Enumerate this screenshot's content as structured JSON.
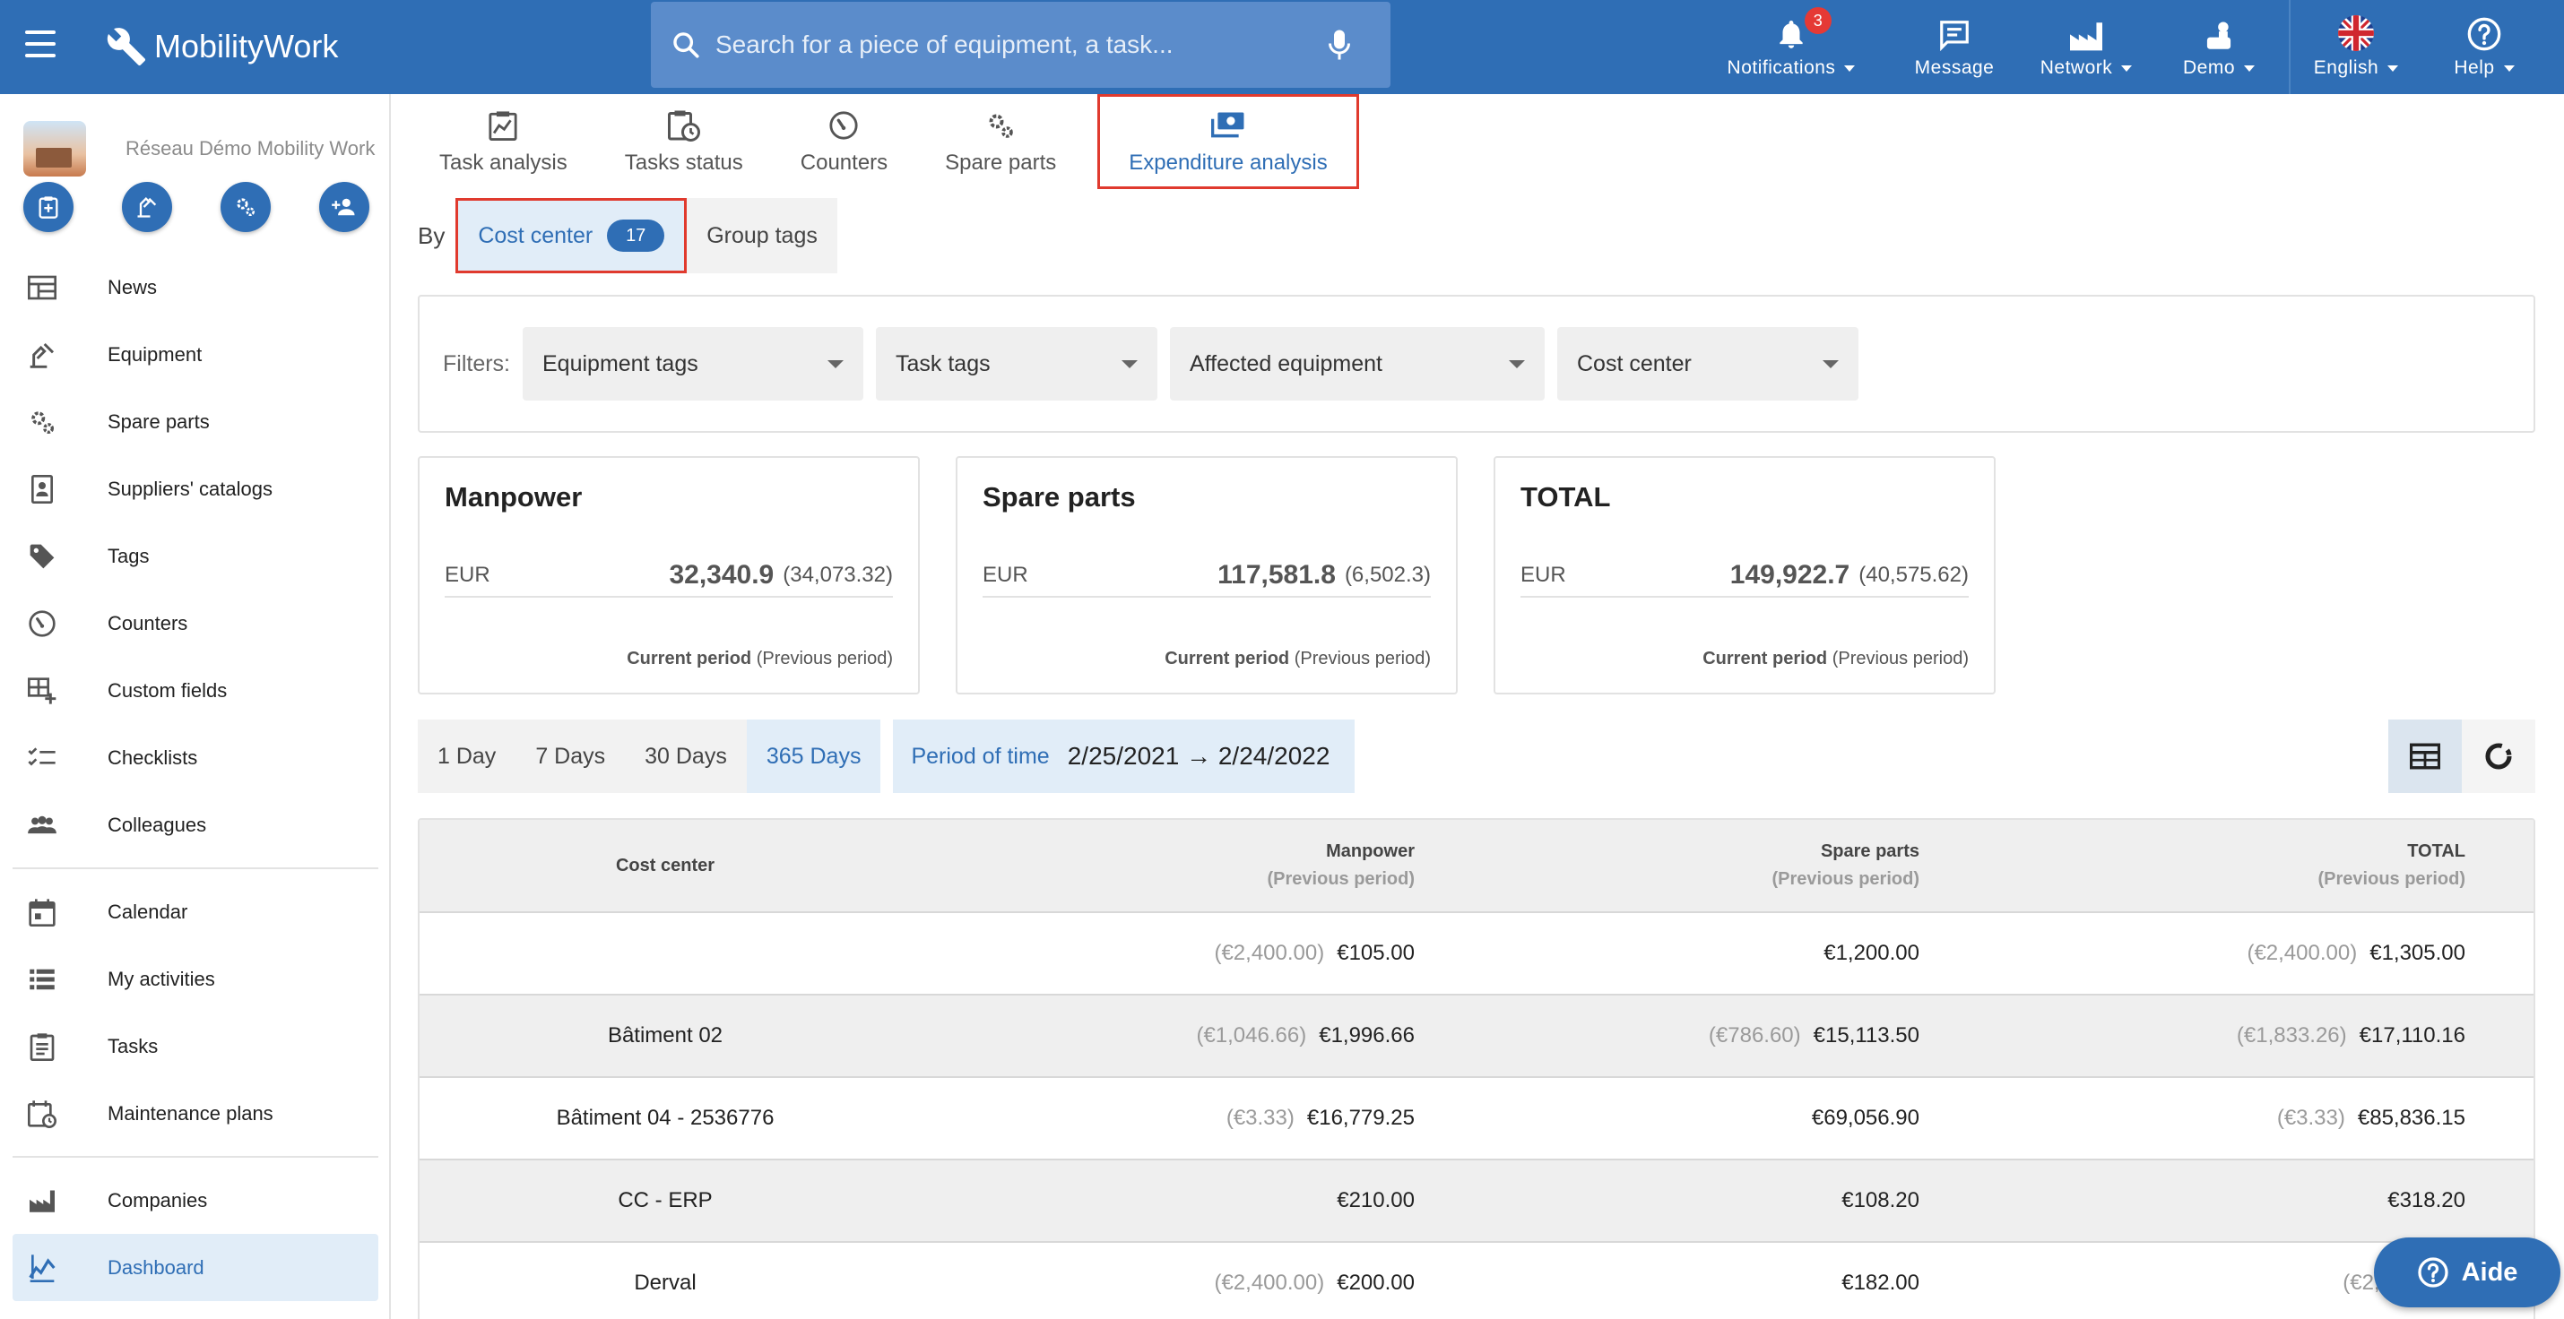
{
  "app": {
    "name": "MobilityWork"
  },
  "search": {
    "placeholder": "Search for a piece of equipment, a task..."
  },
  "topnav": {
    "notifications": {
      "label": "Notifications",
      "badge": "3"
    },
    "message": {
      "label": "Message"
    },
    "network": {
      "label": "Network"
    },
    "demo": {
      "label": "Demo"
    },
    "language": {
      "label": "English"
    },
    "help": {
      "label": "Help"
    }
  },
  "sidebar": {
    "org_name": "Réseau Démo Mobility Work",
    "items": [
      {
        "label": "News",
        "icon": "news-icon"
      },
      {
        "label": "Equipment",
        "icon": "equipment-icon"
      },
      {
        "label": "Spare parts",
        "icon": "gears-icon"
      },
      {
        "label": "Suppliers' catalogs",
        "icon": "catalog-icon"
      },
      {
        "label": "Tags",
        "icon": "tag-icon"
      },
      {
        "label": "Counters",
        "icon": "gauge-icon"
      },
      {
        "label": "Custom fields",
        "icon": "custom-fields-icon"
      },
      {
        "label": "Checklists",
        "icon": "checklist-icon"
      },
      {
        "label": "Colleagues",
        "icon": "people-icon"
      },
      {
        "label": "Calendar",
        "icon": "calendar-icon"
      },
      {
        "label": "My activities",
        "icon": "list-icon"
      },
      {
        "label": "Tasks",
        "icon": "clipboard-icon"
      },
      {
        "label": "Maintenance plans",
        "icon": "maintenance-plan-icon"
      },
      {
        "label": "Companies",
        "icon": "factory-icon"
      },
      {
        "label": "Dashboard",
        "icon": "dashboard-icon"
      }
    ]
  },
  "tabs": [
    "Task analysis",
    "Tasks status",
    "Counters",
    "Spare parts",
    "Expenditure analysis"
  ],
  "by": {
    "label": "By",
    "cost_center": "Cost center",
    "cost_center_count": "17",
    "group_tags": "Group tags"
  },
  "filters": {
    "label": "Filters:",
    "items": [
      "Equipment tags",
      "Task tags",
      "Affected equipment",
      "Cost center"
    ]
  },
  "cards": [
    {
      "title": "Manpower",
      "currency": "EUR",
      "value": "32,340.9",
      "previous": "(34,073.32)",
      "foot_current": "Current period",
      "foot_previous": "(Previous period)"
    },
    {
      "title": "Spare parts",
      "currency": "EUR",
      "value": "117,581.8",
      "previous": "(6,502.3)",
      "foot_current": "Current period",
      "foot_previous": "(Previous period)"
    },
    {
      "title": "TOTAL",
      "currency": "EUR",
      "value": "149,922.7",
      "previous": "(40,575.62)",
      "foot_current": "Current period",
      "foot_previous": "(Previous period)"
    }
  ],
  "periods": [
    "1 Day",
    "7 Days",
    "30 Days",
    "365 Days"
  ],
  "range": {
    "label": "Period of time",
    "value": "2/25/2021 → 2/24/2022"
  },
  "table": {
    "headers": {
      "cost_center": "Cost center",
      "manpower": "Manpower",
      "spare_parts": "Spare parts",
      "total": "TOTAL",
      "previous": "(Previous period)"
    },
    "rows": [
      {
        "name": "",
        "man_prev": "(€2,400.00)",
        "man": "€105.00",
        "sp_prev": "",
        "sp": "€1,200.00",
        "tot_prev": "(€2,400.00)",
        "tot": "€1,305.00"
      },
      {
        "name": "Bâtiment 02",
        "man_prev": "(€1,046.66)",
        "man": "€1,996.66",
        "sp_prev": "(€786.60)",
        "sp": "€15,113.50",
        "tot_prev": "(€1,833.26)",
        "tot": "€17,110.16"
      },
      {
        "name": "Bâtiment 04 - 2536776",
        "man_prev": "(€3.33)",
        "man": "€16,779.25",
        "sp_prev": "",
        "sp": "€69,056.90",
        "tot_prev": "(€3.33)",
        "tot": "€85,836.15"
      },
      {
        "name": "CC - ERP",
        "man_prev": "",
        "man": "€210.00",
        "sp_prev": "",
        "sp": "€108.20",
        "tot_prev": "",
        "tot": "€318.20"
      },
      {
        "name": "Derval",
        "man_prev": "(€2,400.00)",
        "man": "€200.00",
        "sp_prev": "",
        "sp": "€182.00",
        "tot_prev": "(€2,400.00)",
        "tot": ""
      }
    ]
  },
  "aide": {
    "label": "Aide"
  }
}
